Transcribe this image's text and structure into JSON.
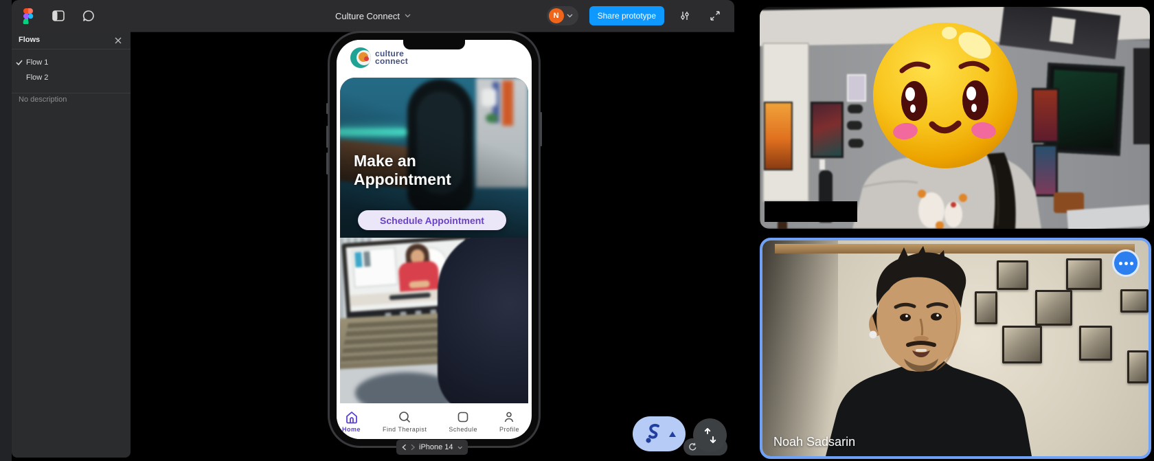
{
  "window": {
    "title": "Culture Connect",
    "share_button": "Share prototype",
    "avatar_initial": "N"
  },
  "flows_panel": {
    "title": "Flows",
    "flows": [
      {
        "label": "Flow 1",
        "selected": true
      },
      {
        "label": "Flow 2",
        "selected": false
      }
    ],
    "description": "No description"
  },
  "prototype": {
    "logo": {
      "line1": "culture",
      "line2": "connect"
    },
    "hero_title": "Make an Appointment",
    "cta_label": "Schedule Appointment",
    "nav": [
      {
        "label": "Home",
        "active": true
      },
      {
        "label": "Find Therapist",
        "active": false
      },
      {
        "label": "Schedule",
        "active": false
      },
      {
        "label": "Profile",
        "active": false
      }
    ],
    "device": "iPhone 14"
  },
  "call": {
    "participants": [
      {
        "name": "",
        "note": "face covered by smiling emoji, name covered by black bar"
      },
      {
        "name": "Noah Sadsarin",
        "active_speaker": true
      }
    ]
  },
  "colors": {
    "share_button": "#0d99ff",
    "toolbar": "#2c2c2e",
    "active_speaker_border": "#6fa2f7",
    "nav_active": "#5b3fd4",
    "cta_text": "#6b41c8",
    "cta_bg": "#ece7f8",
    "avatar": "#f0651a",
    "pointer_pill": "#b7cbf7"
  }
}
